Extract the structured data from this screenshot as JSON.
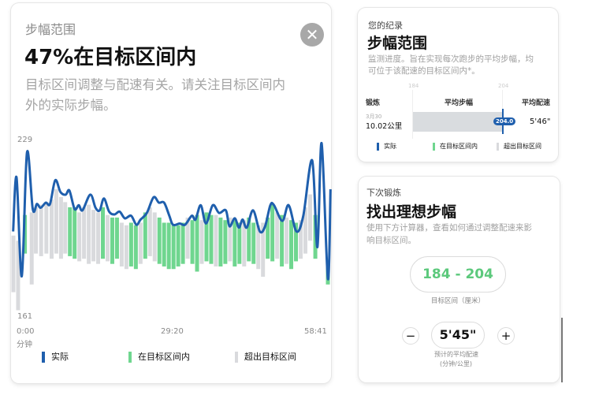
{
  "left_card": {
    "label": "步幅范围",
    "headline": "47%在目标区间内",
    "description_line1": "目标区间调整与配速有关。请关注目标区间内",
    "description_line2": "外的实际步幅。",
    "close_icon": "close-icon",
    "legend": [
      {
        "label": "实际",
        "color": "#1f5fad"
      },
      {
        "label": "在目标区间内",
        "color": "#6fd68f"
      },
      {
        "label": "超出目标区间",
        "color": "#d9dadd"
      }
    ],
    "x_unit": "分钟"
  },
  "chart_data": {
    "type": "line",
    "title": "",
    "xlabel": "分钟",
    "ylabel": "",
    "ylim": [
      161,
      229
    ],
    "xlim": [
      -1,
      60
    ],
    "y_tick_labels": [
      "229",
      "161"
    ],
    "x_ticks": [
      {
        "value": 0,
        "label": "0:00"
      },
      {
        "value": 29.33,
        "label": "29:20"
      },
      {
        "value": 58.68,
        "label": "58:41"
      }
    ],
    "grid": false,
    "line_series": {
      "name": "实际",
      "color": "#1f5fad",
      "x": [
        -0.75,
        -0.1,
        0.9,
        1.9,
        3.0,
        3.8,
        4.5,
        5.5,
        6.3,
        7.3,
        8.3,
        9.3,
        10.0,
        11.0,
        11.8,
        12.5,
        14.0,
        15.0,
        15.8,
        16.6,
        17.6,
        18.6,
        19.6,
        20.6,
        21.8,
        22.8,
        23.6,
        24.8,
        26.1,
        27.1,
        28.1,
        29.1,
        29.8,
        31.1,
        32.1,
        33.4,
        34.1,
        35.1,
        36.1,
        37.4,
        38.6,
        39.9,
        40.6,
        41.6,
        42.4,
        43.1,
        43.9,
        45.1,
        46.4,
        47.4,
        48.4,
        49.1,
        50.7,
        51.9,
        53.4,
        54.7,
        56.4,
        57.4,
        58.2,
        59.4,
        59.9
      ],
      "y": [
        193.6,
        214.6,
        176.2,
        224.3,
        202.3,
        204.3,
        202.8,
        204.8,
        204.3,
        213.5,
        208.9,
        207.9,
        209.5,
        202.3,
        203.8,
        201.8,
        207.9,
        202.8,
        201.8,
        206.4,
        201.3,
        200.2,
        201.3,
        198.7,
        199.7,
        196.2,
        198.2,
        200.8,
        206.9,
        204.8,
        204.8,
        199.7,
        196.2,
        196.7,
        196.2,
        199.7,
        198.2,
        203.8,
        196.7,
        203.8,
        200.8,
        201.8,
        195.6,
        198.7,
        195.1,
        198.2,
        195.1,
        201.8,
        193.6,
        195.6,
        203.8,
        203.8,
        197.7,
        203.8,
        193.6,
        199.7,
        221.2,
        187.5,
        227.9,
        175.2,
        210.0
      ]
    },
    "range_bars": [
      [
        -0.7,
        192,
        170,
        "out"
      ],
      [
        0.2,
        190,
        163,
        "out"
      ],
      [
        1.5,
        200,
        185,
        "in"
      ],
      [
        2.8,
        201,
        173,
        "out"
      ],
      [
        3.6,
        203,
        185,
        "out"
      ],
      [
        4.6,
        204,
        184,
        "out"
      ],
      [
        5.6,
        205,
        185,
        "out"
      ],
      [
        6.6,
        206,
        183,
        "out"
      ],
      [
        7.5,
        210,
        185,
        "out"
      ],
      [
        8.4,
        207,
        183,
        "out"
      ],
      [
        9.2,
        205,
        185,
        "out"
      ],
      [
        10.1,
        203,
        184,
        "in"
      ],
      [
        11.0,
        203,
        183,
        "in"
      ],
      [
        11.9,
        201,
        182,
        "out"
      ],
      [
        12.8,
        203,
        183,
        "out"
      ],
      [
        13.7,
        204,
        181,
        "out"
      ],
      [
        14.6,
        202,
        182,
        "out"
      ],
      [
        15.5,
        201,
        181,
        "out"
      ],
      [
        16.4,
        203,
        183,
        "in"
      ],
      [
        17.3,
        200,
        182,
        "out"
      ],
      [
        18.2,
        199,
        181,
        "in"
      ],
      [
        19.1,
        199,
        183,
        "in"
      ],
      [
        20.0,
        197,
        180,
        "out"
      ],
      [
        20.9,
        196,
        179,
        "out"
      ],
      [
        21.8,
        197,
        180,
        "in"
      ],
      [
        22.7,
        196,
        179,
        "in"
      ],
      [
        23.6,
        197,
        181,
        "out"
      ],
      [
        24.5,
        201,
        183,
        "in"
      ],
      [
        25.4,
        203,
        184,
        "out"
      ],
      [
        26.3,
        201,
        182,
        "out"
      ],
      [
        27.2,
        199,
        181,
        "in"
      ],
      [
        28.1,
        197,
        180,
        "in"
      ],
      [
        29.0,
        197,
        179,
        "in"
      ],
      [
        29.9,
        196,
        179,
        "in"
      ],
      [
        30.8,
        196,
        180,
        "in"
      ],
      [
        31.7,
        197,
        181,
        "in"
      ],
      [
        32.6,
        199,
        183,
        "out"
      ],
      [
        33.5,
        198,
        181,
        "in"
      ],
      [
        34.4,
        200,
        178,
        "in"
      ],
      [
        35.3,
        198,
        181,
        "out"
      ],
      [
        36.2,
        201,
        182,
        "in"
      ],
      [
        37.1,
        200,
        181,
        "in"
      ],
      [
        38.0,
        200,
        180,
        "out"
      ],
      [
        38.9,
        199,
        180,
        "in"
      ],
      [
        39.8,
        198,
        181,
        "in"
      ],
      [
        40.7,
        199,
        182,
        "out"
      ],
      [
        41.6,
        198,
        180,
        "in"
      ],
      [
        42.5,
        197,
        181,
        "in"
      ],
      [
        43.4,
        198,
        180,
        "out"
      ],
      [
        44.3,
        199,
        182,
        "in"
      ],
      [
        45.2,
        197,
        181,
        "in"
      ],
      [
        46.1,
        196,
        179,
        "out"
      ],
      [
        47.0,
        197,
        176,
        "out"
      ],
      [
        47.9,
        199,
        183,
        "in"
      ],
      [
        48.8,
        204,
        182,
        "in"
      ],
      [
        49.7,
        201,
        183,
        "out"
      ],
      [
        50.6,
        200,
        180,
        "in"
      ],
      [
        51.5,
        199,
        181,
        "out"
      ],
      [
        52.4,
        198,
        179,
        "in"
      ],
      [
        53.3,
        197,
        182,
        "in"
      ],
      [
        54.2,
        198,
        183,
        "out"
      ],
      [
        55.1,
        203,
        185,
        "out"
      ],
      [
        56.0,
        208,
        190,
        "out"
      ],
      [
        57.0,
        200,
        183,
        "in"
      ],
      [
        59.4,
        180,
        173,
        "in"
      ]
    ],
    "colors": {
      "in": "#6fd68f",
      "out": "#d9dadd"
    }
  },
  "record_card": {
    "label": "您的纪录",
    "title": "步幅范围",
    "description_line1": "监测进度。旨在实现每次跑步的平均步幅，均",
    "description_line2": "可位于该配速的目标区间内*。",
    "scale_low": "184",
    "scale_high": "204",
    "columns": [
      "锻炼",
      "平均步幅",
      "平均配速"
    ],
    "row": {
      "date": "3月30",
      "distance": "10.02公里",
      "stride": "204.0",
      "pace": "5'46\""
    },
    "legend": [
      "实际",
      "在目标区间内",
      "超出目标区间"
    ]
  },
  "next_card": {
    "label": "下次锻炼",
    "title": "找出理想步幅",
    "description_line1": "使用下方计算器，查看如何通过调整配速来影",
    "description_line2": "响目标区间。",
    "target_range": "184 - 204",
    "target_label": "目标区间（厘米）",
    "pace_value": "5'45\"",
    "minus": "−",
    "plus": "+",
    "pace_label_line1": "预计的平均配速",
    "pace_label_line2": "(分钟/公里)"
  }
}
